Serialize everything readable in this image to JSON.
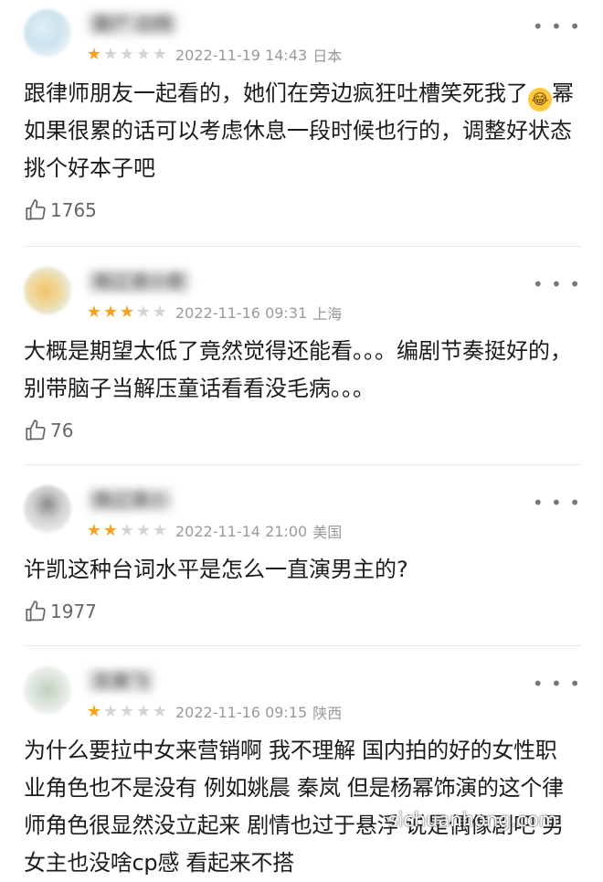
{
  "reviews": [
    {
      "username": "菌尸 白杨",
      "rating": 1,
      "date": "2022-11-19 14:43",
      "location": "日本",
      "text_before_emoji": "跟律师朋友一起看的，她们在旁边疯狂吐槽笑死我了",
      "emoji": "rolling-on-floor-laughing",
      "text_after_emoji": "幂如果很累的话可以考虑休息一段时候也行的，调整好状态挑个好本子吧",
      "likes": "1765"
    },
    {
      "username": "南辽清小奇",
      "rating": 3,
      "date": "2022-11-16 09:31",
      "location": "上海",
      "text": "大概是期望太低了竟然觉得还能看。。。编剧节奏挺好的，别带脑子当解压童话看看没毛病。。。",
      "likes": "76"
    },
    {
      "username": "南辽清小",
      "rating": 2,
      "date": "2022-11-14 21:00",
      "location": "美国",
      "text": "许凯这种台词水平是怎么一直演男主的?",
      "likes": "1977"
    },
    {
      "username": "无辜飞",
      "rating": 1,
      "date": "2022-11-16 09:15",
      "location": "陕西",
      "text": "为什么要拉中女来营销啊 我不理解 国内拍的好的女性职业角色也不是没有 例如姚晨 秦岚 但是杨幂饰演的这个律师角色很显然没立起来 剧情也过于悬浮 说是偶像剧吧 男女主也没啥cp感 看起来不搭",
      "likes": ""
    }
  ],
  "icons": {
    "more": "more-dots-icon",
    "like": "thumbs-up-icon",
    "star": "star-icon"
  },
  "watermark": "sichuanhong.com",
  "colors": {
    "star_on": "#f4a21f",
    "star_off": "#d4d4d4",
    "meta_text": "#9a9a9a",
    "body_text": "#1c1c1c"
  }
}
